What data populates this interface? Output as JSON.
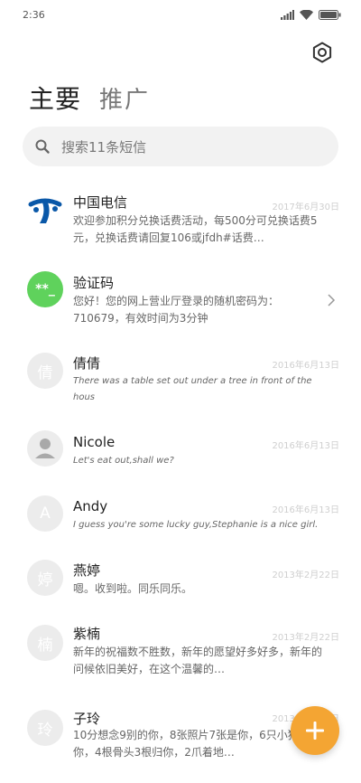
{
  "status_bar": {
    "time": "2:36"
  },
  "tabs": {
    "main": "主要",
    "promo": "推广"
  },
  "search": {
    "placeholder": "搜索11条短信"
  },
  "messages": [
    {
      "name": "中国电信",
      "date": "2017年6月30日",
      "preview": "欢迎参加积分兑换话费活动，每500分可兑换话费5元，兑换话费请回复106或jfdh#话费…",
      "avatar": "telecom-logo"
    },
    {
      "name": "验证码",
      "date": "",
      "preview": "您好！您的网上营业厅登录的随机密码为：710679，有效时间为3分钟",
      "avatar_text": "**_"
    },
    {
      "name": "倩倩",
      "date": "2016年6月13日",
      "preview": "There was a table set out under a tree in front of the hous",
      "avatar_text": "倩"
    },
    {
      "name": "Nicole",
      "date": "2016年6月13日",
      "preview": "Let's eat out,shall we?",
      "avatar": "person-icon"
    },
    {
      "name": "Andy",
      "date": "2016年6月13日",
      "preview": "I guess you're some lucky guy,Stephanie is a nice girl.",
      "avatar_text": "A"
    },
    {
      "name": "燕婷",
      "date": "2013年2月22日",
      "preview": "嗯。收到啦。同乐同乐。",
      "avatar_text": "婷"
    },
    {
      "name": "紫楠",
      "date": "2013年2月22日",
      "preview": "新年的祝福数不胜数，新年的愿望好多好多，新年的问候依旧美好，在这个温馨的…",
      "avatar_text": "楠"
    },
    {
      "name": "子玲",
      "date": "2013年2月22日",
      "preview": "10分想念9别的你，8张照片7张是你，6只小狗5只像你，4根骨头3根归你，2爪着地…",
      "avatar_text": "玲"
    }
  ],
  "colors": {
    "accent": "#f4a533",
    "green_avatar": "#5fd25c",
    "telecom_blue": "#0a58a8"
  }
}
